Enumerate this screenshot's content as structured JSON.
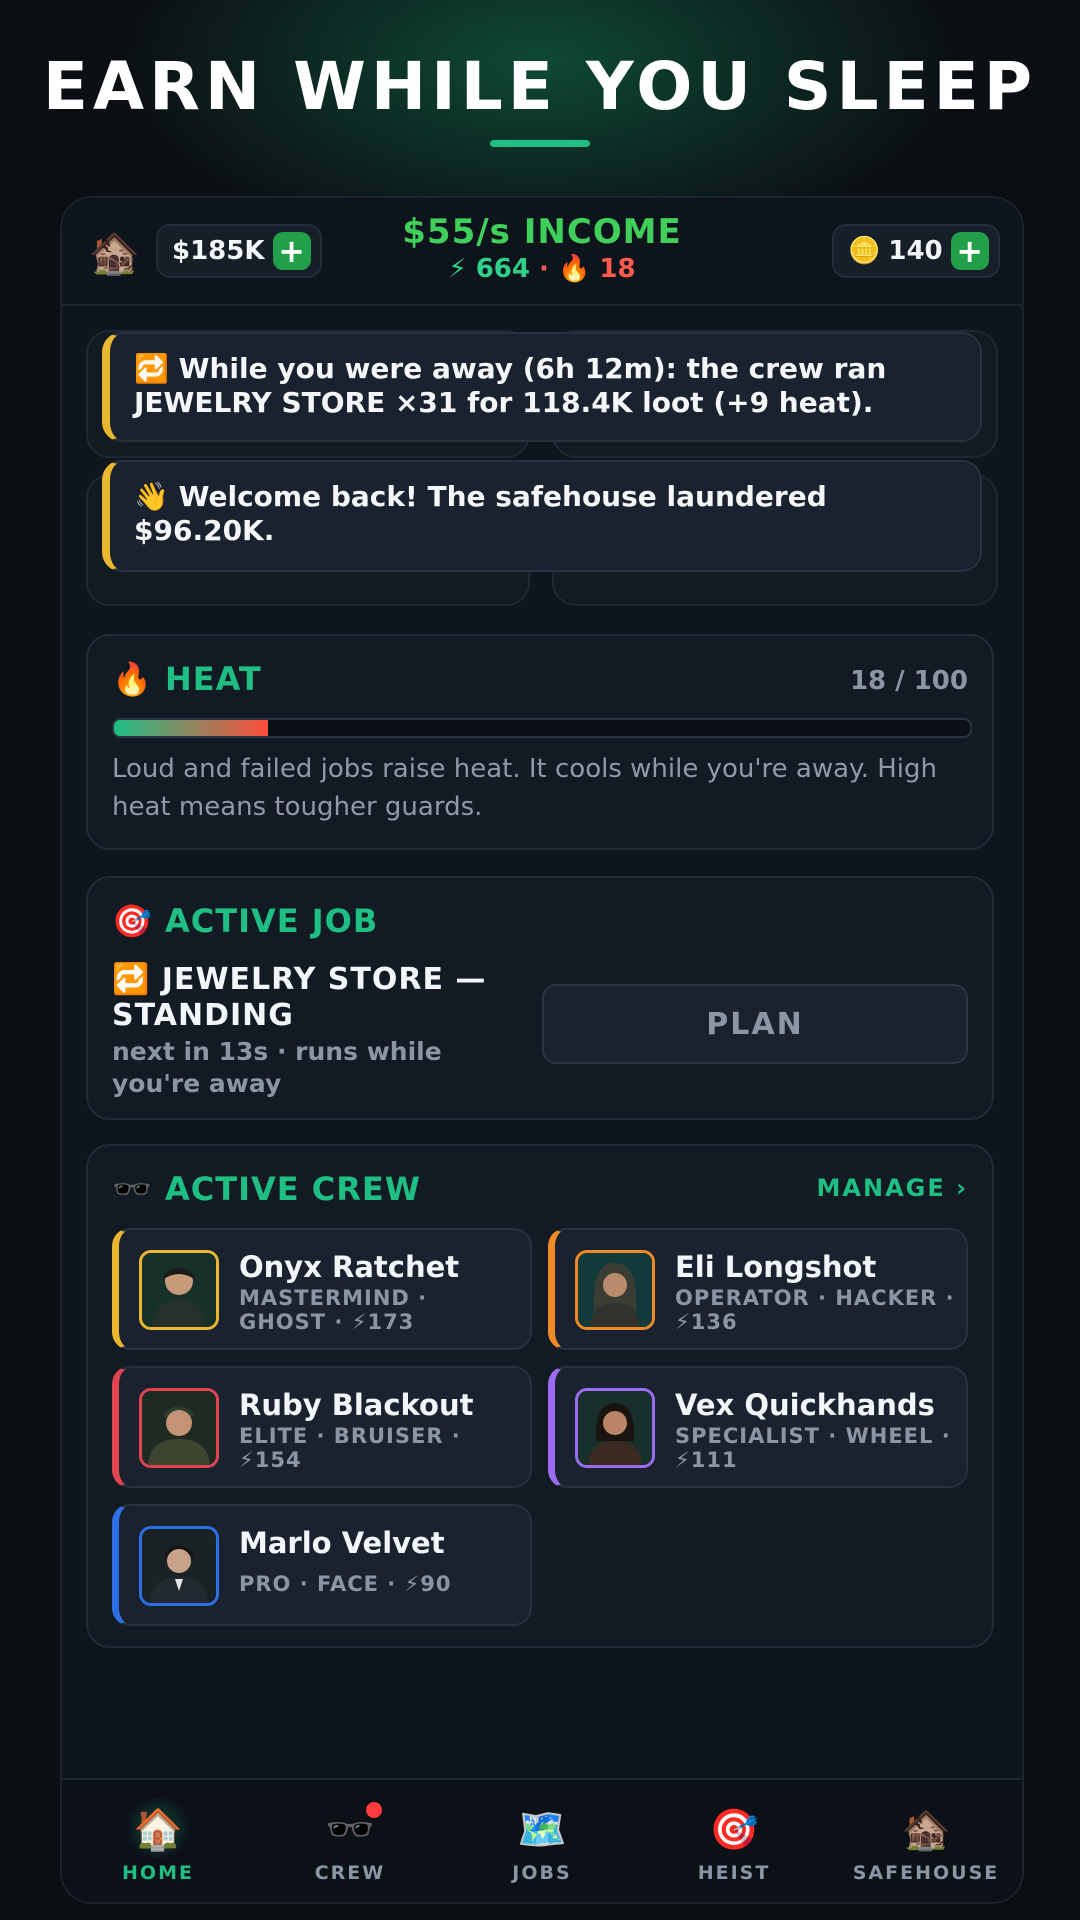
{
  "headline": "EARN WHILE YOU SLEEP",
  "topbar": {
    "home_icon": "house-icon",
    "cash": "$185K",
    "income": "$55/s INCOME",
    "energy": "⚡ 664",
    "separator": "·",
    "heat": "🔥 18",
    "coins_icon": "coin-icon",
    "coins": "140"
  },
  "notices": [
    "🔁 While you were away (6h 12m): the crew ran JEWELRY STORE ×31 for 118.4K loot (+9 heat).",
    "👋 Welcome back! The safehouse laundered $96.20K."
  ],
  "heat_card": {
    "icon": "🔥",
    "title": "HEAT",
    "count": "18 / 100",
    "level": 0.18,
    "description": "Loud and failed jobs raise heat. It cools while you're away. High heat means tougher guards."
  },
  "active_job": {
    "icon": "🎯",
    "title": "ACTIVE JOB",
    "name": "🔁 JEWELRY STORE — STANDING",
    "subtitle": "next in 13s · runs while you're away",
    "plan_label": "PLAN"
  },
  "crew_card": {
    "icon": "🕶️",
    "title": "ACTIVE CREW",
    "manage": "MANAGE ›",
    "members": [
      {
        "name": "Onyx Ratchet",
        "role": "MASTERMIND · GHOST · ⚡173",
        "color": "#e9b730"
      },
      {
        "name": "Eli Longshot",
        "role": "OPERATOR · HACKER · ⚡136",
        "color": "#f08a24"
      },
      {
        "name": "Ruby Blackout",
        "role": "ELITE · BRUISER · ⚡154",
        "color": "#e0444f"
      },
      {
        "name": "Vex Quickhands",
        "role": "SPECIALIST · WHEEL · ⚡111",
        "color": "#9b6cf2"
      },
      {
        "name": "Marlo Velvet",
        "role": "PRO · FACE · ⚡90",
        "color": "#2f6fe6"
      }
    ]
  },
  "nav": [
    {
      "icon": "🏠",
      "label": "HOME",
      "active": true
    },
    {
      "icon": "🕶️",
      "label": "CREW",
      "active": false
    },
    {
      "icon": "🗺️",
      "label": "JOBS",
      "active": false
    },
    {
      "icon": "🎯",
      "label": "HEIST",
      "active": false
    },
    {
      "icon": "🏚️",
      "label": "SAFEHOUSE",
      "active": false
    }
  ],
  "colors": {
    "accent": "#1fbf84",
    "income": "#3fcf5a",
    "heat": "#ff5a4d",
    "background": "#0b0f14"
  }
}
